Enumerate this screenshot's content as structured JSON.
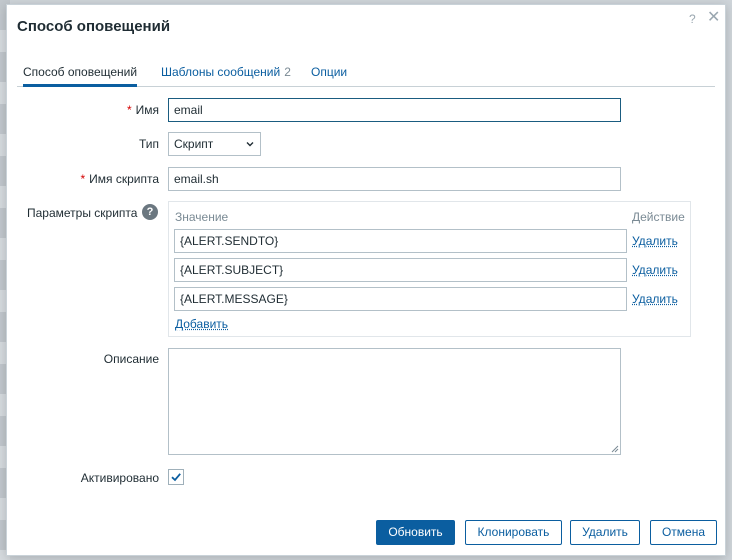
{
  "dialog": {
    "title": "Способ оповещений",
    "help_glyph": "?",
    "close_glyph": "✕"
  },
  "tabs": [
    {
      "label": "Способ оповещений",
      "active": true
    },
    {
      "label": "Шаблоны сообщений",
      "count": "2"
    },
    {
      "label": "Опции"
    }
  ],
  "form": {
    "required_mark": "*",
    "name": {
      "label": "Имя",
      "value": "email"
    },
    "type": {
      "label": "Тип",
      "value": "Скрипт"
    },
    "script_name": {
      "label": "Имя скрипта",
      "value": "email.sh"
    },
    "script_params": {
      "label": "Параметры скрипта",
      "help_glyph": "?",
      "col_value": "Значение",
      "col_action": "Действие",
      "rows": [
        {
          "value": "{ALERT.SENDTO}",
          "action": "Удалить"
        },
        {
          "value": "{ALERT.SUBJECT}",
          "action": "Удалить"
        },
        {
          "value": "{ALERT.MESSAGE}",
          "action": "Удалить"
        }
      ],
      "add_label": "Добавить"
    },
    "description": {
      "label": "Описание",
      "value": ""
    },
    "enabled": {
      "label": "Активировано",
      "checked": true
    }
  },
  "buttons": {
    "update": "Обновить",
    "clone": "Клонировать",
    "delete": "Удалить",
    "cancel": "Отмена"
  },
  "colors": {
    "accent": "#0b5ea0",
    "required": "#d40000"
  }
}
